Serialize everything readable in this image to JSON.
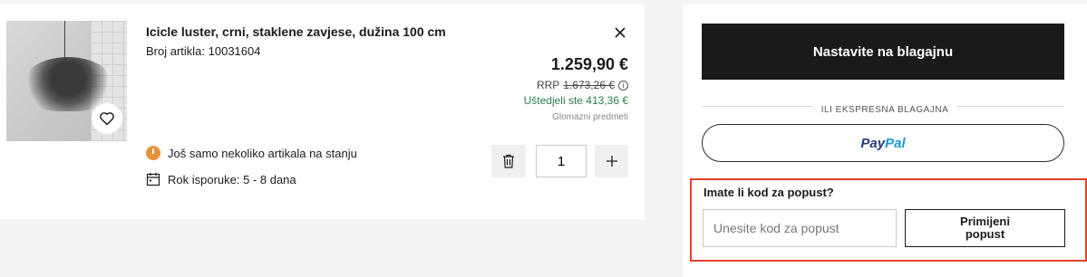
{
  "cart_item": {
    "title": "Icicle luster, crni, staklene zavjese, dužina 100 cm",
    "sku": "Broj artikla: 10031604",
    "price": "1.259,90 €",
    "rrp_label": "RRP",
    "rrp_value": "1.673,26 €",
    "savings": "Uštedjeli ste 413,36 €",
    "category": "Glomazni predmeti",
    "stock_note": "Još samo nekoliko artikala na stanju",
    "delivery": "Rok isporuke: 5 - 8 dana",
    "quantity": "1",
    "icons": [
      "heart-icon",
      "close-icon",
      "clock-icon",
      "calendar-icon",
      "trash-icon",
      "plus-icon",
      "info-icon"
    ]
  },
  "checkout": {
    "checkout_label": "Nastavite na blagajnu",
    "express_label": "ILI EKSPRESNA BLAGAJNA",
    "paypal_part1": "Pay",
    "paypal_part2": "Pal"
  },
  "promo": {
    "label": "Imate li kod za popust?",
    "placeholder": "Unesite kod za popust",
    "apply_label": "Primijeni popust"
  },
  "colors": {
    "accent_highlight": "#e2412a",
    "savings_green": "#2e7d4f",
    "stock_orange": "#e8913a",
    "button_dark": "#1a1a1a"
  }
}
